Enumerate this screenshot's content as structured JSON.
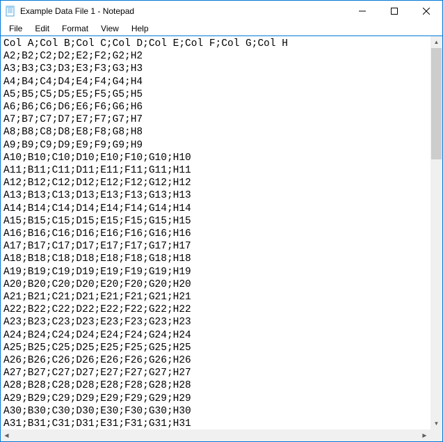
{
  "window": {
    "title": "Example Data File 1 - Notepad"
  },
  "menu": {
    "items": [
      "File",
      "Edit",
      "Format",
      "View",
      "Help"
    ]
  },
  "editor": {
    "lines": [
      "Col A;Col B;Col C;Col D;Col E;Col F;Col G;Col H",
      "A2;B2;C2;D2;E2;F2;G2;H2",
      "A3;B3;C3;D3;E3;F3;G3;H3",
      "A4;B4;C4;D4;E4;F4;G4;H4",
      "A5;B5;C5;D5;E5;F5;G5;H5",
      "A6;B6;C6;D6;E6;F6;G6;H6",
      "A7;B7;C7;D7;E7;F7;G7;H7",
      "A8;B8;C8;D8;E8;F8;G8;H8",
      "A9;B9;C9;D9;E9;F9;G9;H9",
      "A10;B10;C10;D10;E10;F10;G10;H10",
      "A11;B11;C11;D11;E11;F11;G11;H11",
      "A12;B12;C12;D12;E12;F12;G12;H12",
      "A13;B13;C13;D13;E13;F13;G13;H13",
      "A14;B14;C14;D14;E14;F14;G14;H14",
      "A15;B15;C15;D15;E15;F15;G15;H15",
      "A16;B16;C16;D16;E16;F16;G16;H16",
      "A17;B17;C17;D17;E17;F17;G17;H17",
      "A18;B18;C18;D18;E18;F18;G18;H18",
      "A19;B19;C19;D19;E19;F19;G19;H19",
      "A20;B20;C20;D20;E20;F20;G20;H20",
      "A21;B21;C21;D21;E21;F21;G21;H21",
      "A22;B22;C22;D22;E22;F22;G22;H22",
      "A23;B23;C23;D23;E23;F23;G23;H23",
      "A24;B24;C24;D24;E24;F24;G24;H24",
      "A25;B25;C25;D25;E25;F25;G25;H25",
      "A26;B26;C26;D26;E26;F26;G26;H26",
      "A27;B27;C27;D27;E27;F27;G27;H27",
      "A28;B28;C28;D28;E28;F28;G28;H28",
      "A29;B29;C29;D29;E29;F29;G29;H29",
      "A30;B30;C30;D30;E30;F30;G30;H30",
      "A31;B31;C31;D31;E31;F31;G31;H31"
    ]
  }
}
